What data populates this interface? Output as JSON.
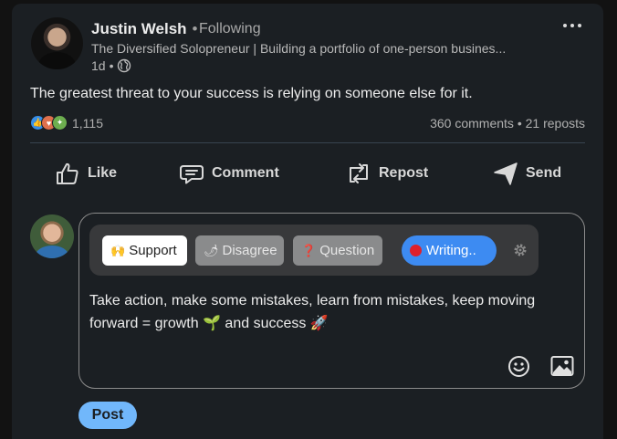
{
  "post": {
    "author_name": "Justin Welsh",
    "separator": "•",
    "follow_status": "Following",
    "headline": "The Diversified Solopreneur | Building a portfolio of one-person busines...",
    "time": "1d",
    "time_separator": "•",
    "visibility_icon": "globe-icon",
    "text": "The greatest threat to your success is relying on someone else for it."
  },
  "social": {
    "reaction_icons": [
      "like-icon",
      "love-icon",
      "support-icon"
    ],
    "reaction_count": "1,115",
    "comments": "360 comments",
    "stats_separator": "•",
    "reposts": "21 reposts"
  },
  "actions": {
    "like": "Like",
    "comment": "Comment",
    "repost": "Repost",
    "send": "Send"
  },
  "composer": {
    "chips": {
      "support_emoji": "🙌",
      "support": "Support",
      "disagree_emoji": "🌶",
      "disagree": "Disagree",
      "question_emoji": "❓",
      "question": "Question",
      "writing": "Writing.."
    },
    "comment_text": "Take action, make some mistakes, learn from mistakes, keep moving forward = growth 🌱 and success 🚀",
    "post_button": "Post"
  },
  "colors": {
    "card_bg": "#1b1f23",
    "page_bg": "#121212",
    "accent_blue": "#3d8bf2",
    "post_button": "#71b7fb",
    "record_red": "#e0202a"
  }
}
